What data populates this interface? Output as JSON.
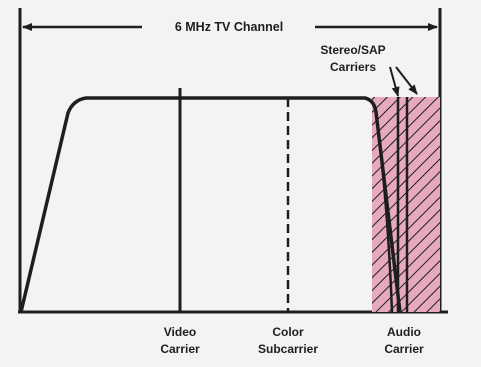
{
  "diagram": {
    "channel_label": "6 MHz TV Channel",
    "stereo_label_line1": "Stereo/SAP",
    "stereo_label_line2": "Carriers",
    "video_label_line1": "Video",
    "video_label_line2": "Carrier",
    "color_label_line1": "Color",
    "color_label_line2": "Subcarrier",
    "audio_label_line1": "Audio",
    "audio_label_line2": "Carrier"
  },
  "colors": {
    "line": "#1e1e1e",
    "hatch_fill": "#e6a9bf",
    "background": "#f3f3f1"
  }
}
